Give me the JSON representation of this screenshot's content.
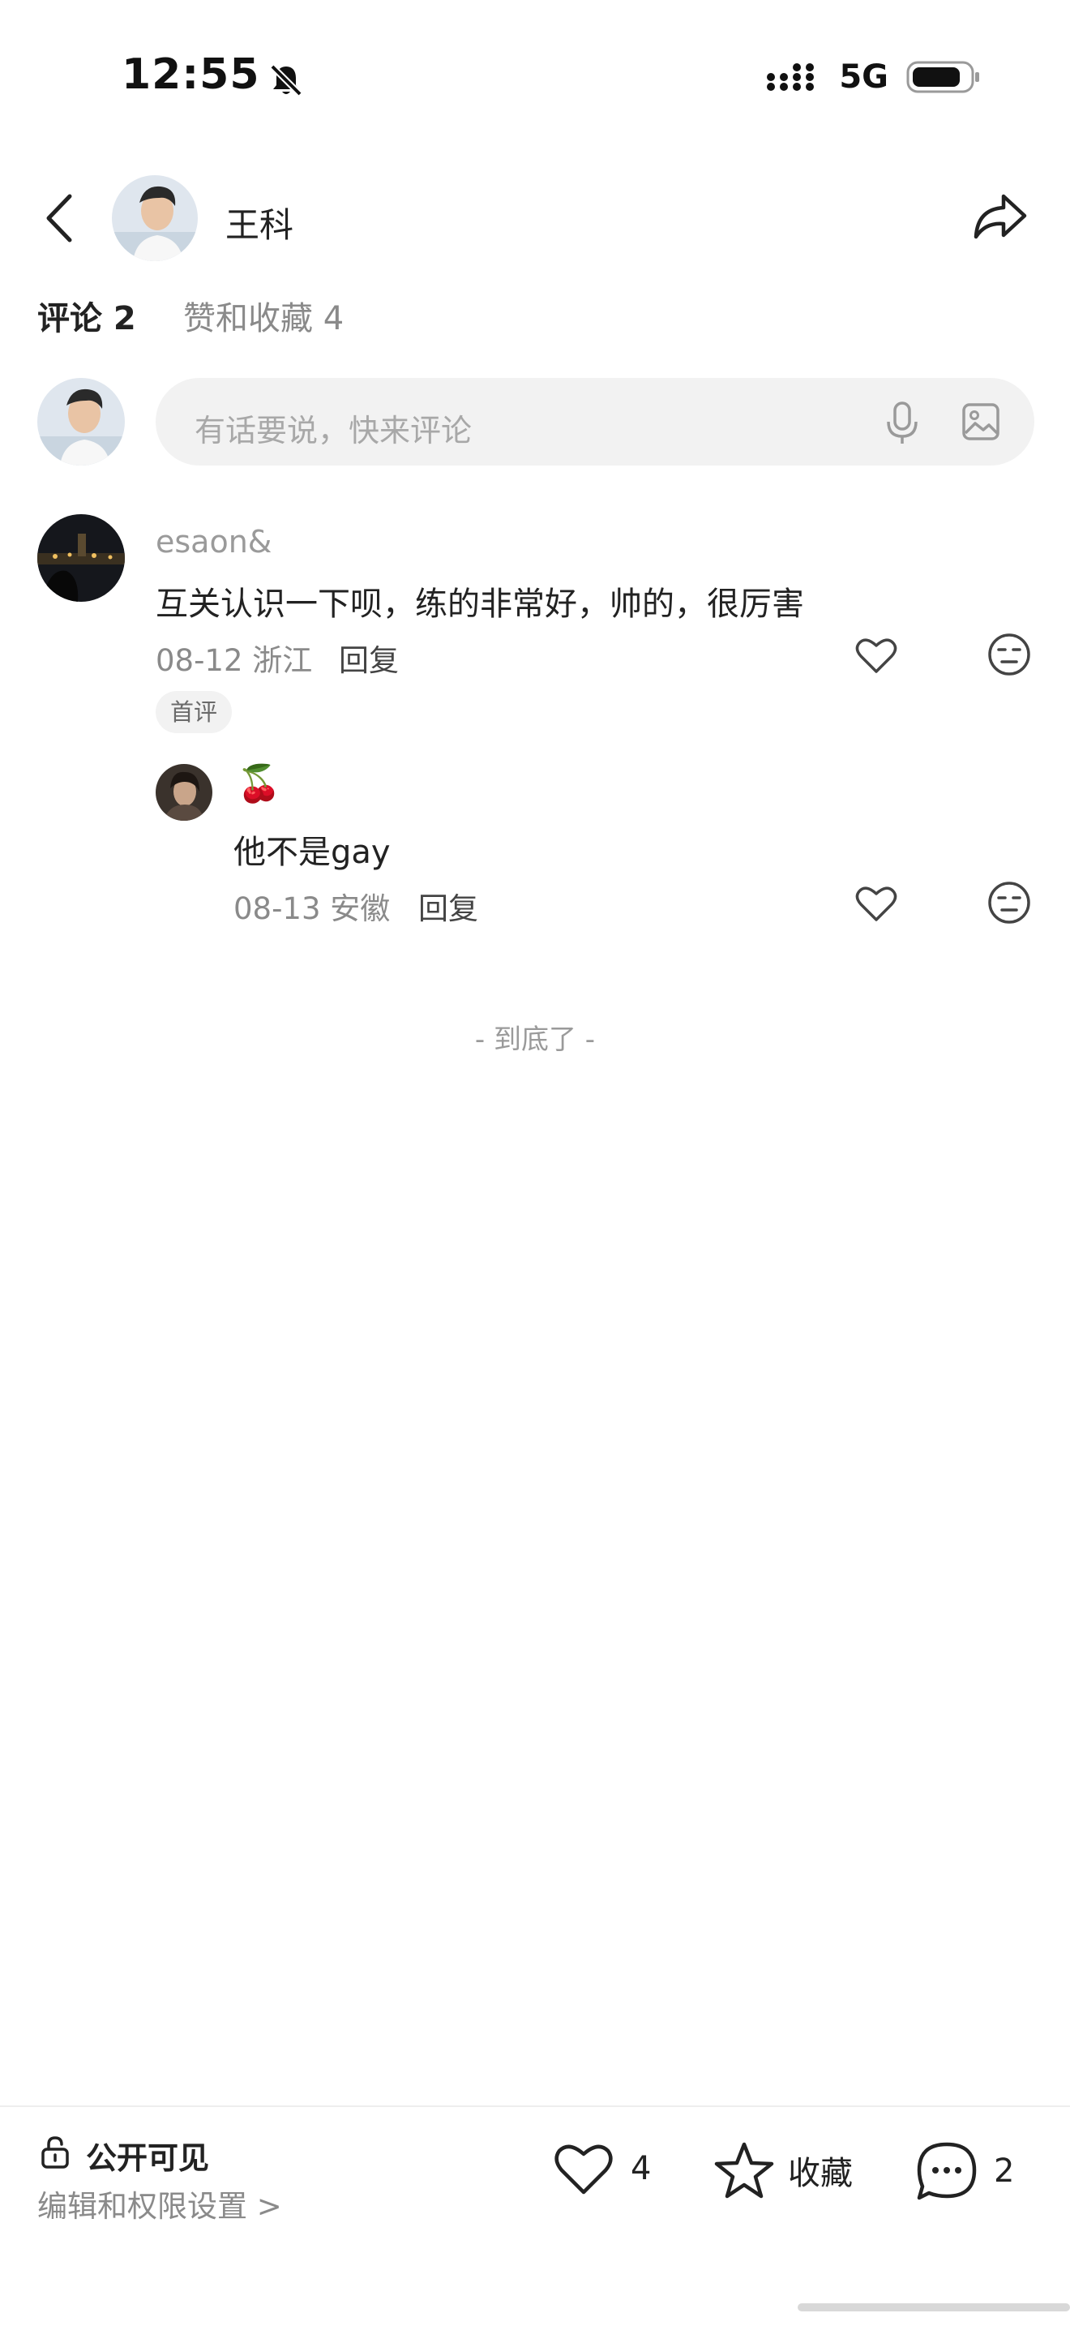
{
  "status_bar": {
    "time": "12:55",
    "network": "5G"
  },
  "header": {
    "name": "王科"
  },
  "tabs": [
    {
      "label": "评论 2"
    },
    {
      "label": "赞和收藏 4"
    }
  ],
  "comment_input": {
    "placeholder": "有话要说，快来评论"
  },
  "comments": [
    {
      "user": "esaon&",
      "text": "互关认识一下呗，练的非常好，帅的，很厉害",
      "date": "08-12 浙江",
      "reply_label": "回复",
      "badge": "首评",
      "replies": [
        {
          "user": "🍒",
          "text": "他不是gay",
          "date": "08-13 安徽",
          "reply_label": "回复"
        }
      ]
    }
  ],
  "end_text": "- 到底了 -",
  "bottom_bar": {
    "visibility": "公开可见",
    "edit_permissions": "编辑和权限设置 >",
    "like_count": "4",
    "favorite_label": "收藏",
    "comment_count": "2"
  },
  "colors": {
    "primary_text": "#222222",
    "secondary_text": "#8a8a8a",
    "input_bg": "#f2f2f2"
  }
}
